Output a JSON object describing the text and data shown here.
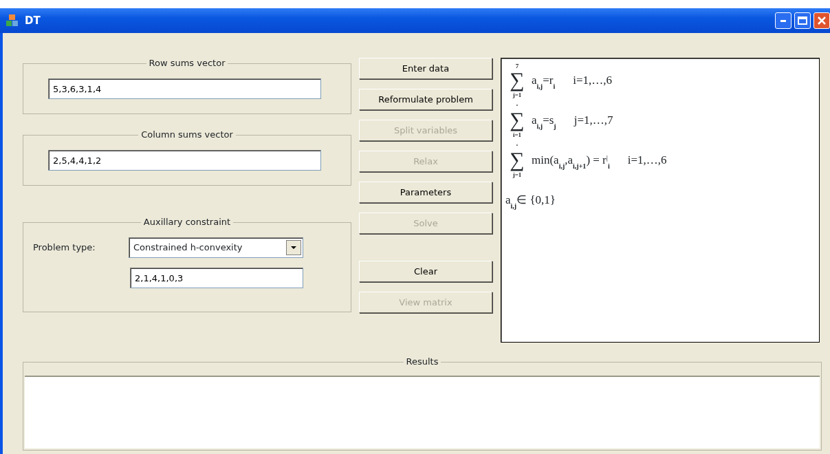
{
  "window": {
    "title": "DT"
  },
  "row_sums": {
    "legend": "Row sums vector",
    "value": "5,3,6,3,1,4"
  },
  "column_sums": {
    "legend": "Column sums vector",
    "value": "2,5,4,4,1,2"
  },
  "auxiliary": {
    "legend": "Auxillary constraint",
    "problem_type_label": "Problem type:",
    "problem_type": "Constrained h-convexity",
    "value": "2,1,4,1,0,3"
  },
  "buttons": [
    {
      "label": "Enter data",
      "disabled": false
    },
    {
      "label": "Reformulate problem",
      "disabled": false
    },
    {
      "label": "Split variables",
      "disabled": true
    },
    {
      "label": "Relax",
      "disabled": true
    },
    {
      "label": "Parameters",
      "disabled": false
    },
    {
      "label": "Solve",
      "disabled": true
    },
    {
      "label": "Clear",
      "disabled": false
    },
    {
      "label": "View matrix",
      "disabled": true
    }
  ],
  "formulas": [
    {
      "symbol": "∑",
      "upper": "7",
      "lower": "j=1",
      "body": "a$_{i,j}$=r$_{i}$",
      "range": "i=1,…,6"
    },
    {
      "symbol": "∑",
      "upper": "‘",
      "lower": "i=1",
      "body": "a$_{i,j}$=s$_{j}$",
      "range": "j=1,…,7"
    },
    {
      "symbol": "∑",
      "upper": "‘",
      "lower": "j=1",
      "body": "min(a$_{i,j}$,a$_{i,j+1}$) = r$^{|}$$_{i}$",
      "range": "i=1,…,6"
    },
    {
      "body": "a$_{i,j}$∈ {0,1}"
    }
  ],
  "results": {
    "legend": "Results"
  }
}
